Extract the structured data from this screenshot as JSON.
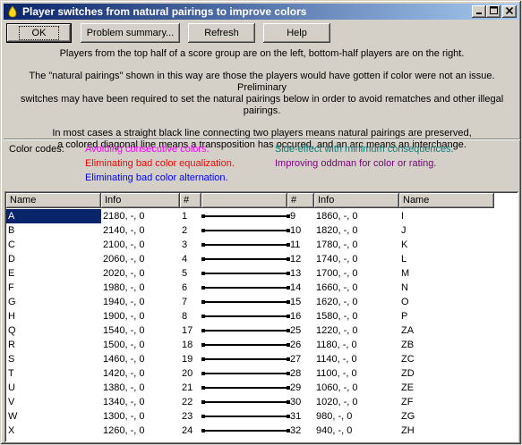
{
  "window": {
    "title": "Player switches from natural pairings to improve colors",
    "buttons": {
      "minimize": "_",
      "maximize": "□",
      "close": "×"
    }
  },
  "toolbar": {
    "ok": "OK",
    "summary": "Problem summary...",
    "refresh": "Refresh",
    "help": "Help"
  },
  "info": {
    "p1": "Players from the top half of a score group are on the left, bottom-half players are on the right.",
    "p2a": "The \"natural pairings\" shown in this way are those the players would have gotten if color were not an issue. Preliminary",
    "p2b": "switches may have been required to set the natural pairings below in order to avoid rematches and other illegal pairings.",
    "p3a": "In most cases a straight black line connecting two players means natural pairings are preserved,",
    "p3b": "a colored diagonal line means a transposition has occured, and an arc means an interchange."
  },
  "color_codes": {
    "label": "Color codes:",
    "items": [
      {
        "text": "Avoiding consecutive colors.",
        "color": "#ff00ff"
      },
      {
        "text": "Side-effect with minimum consequences.",
        "color": "#008080"
      },
      {
        "text": "Eliminating bad color equalization.",
        "color": "#ff0000"
      },
      {
        "text": "Improving oddman for color or rating.",
        "color": "#800080"
      },
      {
        "text": "Eliminating bad color alternation.",
        "color": "#0000ff"
      }
    ]
  },
  "columns": [
    "Name",
    "Info",
    "#",
    "#",
    "Info",
    "Name"
  ],
  "rows": [
    {
      "l_name": "A",
      "l_info": "2180, -, 0",
      "l_num": "1",
      "r_num": "9",
      "r_info": "1860, -, 0",
      "r_name": "I"
    },
    {
      "l_name": "B",
      "l_info": "2140, -, 0",
      "l_num": "2",
      "r_num": "10",
      "r_info": "1820, -, 0",
      "r_name": "J"
    },
    {
      "l_name": "C",
      "l_info": "2100, -, 0",
      "l_num": "3",
      "r_num": "11",
      "r_info": "1780, -, 0",
      "r_name": "K"
    },
    {
      "l_name": "D",
      "l_info": "2060, -, 0",
      "l_num": "4",
      "r_num": "12",
      "r_info": "1740, -, 0",
      "r_name": "L"
    },
    {
      "l_name": "E",
      "l_info": "2020, -, 0",
      "l_num": "5",
      "r_num": "13",
      "r_info": "1700, -, 0",
      "r_name": "M"
    },
    {
      "l_name": "F",
      "l_info": "1980, -, 0",
      "l_num": "6",
      "r_num": "14",
      "r_info": "1660, -, 0",
      "r_name": "N"
    },
    {
      "l_name": "G",
      "l_info": "1940, -, 0",
      "l_num": "7",
      "r_num": "15",
      "r_info": "1620, -, 0",
      "r_name": "O"
    },
    {
      "l_name": "H",
      "l_info": "1900, -, 0",
      "l_num": "8",
      "r_num": "16",
      "r_info": "1580, -, 0",
      "r_name": "P"
    },
    {
      "l_name": "Q",
      "l_info": "1540, -, 0",
      "l_num": "17",
      "r_num": "25",
      "r_info": "1220, -, 0",
      "r_name": "ZA"
    },
    {
      "l_name": "R",
      "l_info": "1500, -, 0",
      "l_num": "18",
      "r_num": "26",
      "r_info": "1180, -, 0",
      "r_name": "ZB"
    },
    {
      "l_name": "S",
      "l_info": "1460, -, 0",
      "l_num": "19",
      "r_num": "27",
      "r_info": "1140, -, 0",
      "r_name": "ZC"
    },
    {
      "l_name": "T",
      "l_info": "1420, -, 0",
      "l_num": "20",
      "r_num": "28",
      "r_info": "1100, -, 0",
      "r_name": "ZD"
    },
    {
      "l_name": "U",
      "l_info": "1380, -, 0",
      "l_num": "21",
      "r_num": "29",
      "r_info": "1060, -, 0",
      "r_name": "ZE"
    },
    {
      "l_name": "V",
      "l_info": "1340, -, 0",
      "l_num": "22",
      "r_num": "30",
      "r_info": "1020, -, 0",
      "r_name": "ZF"
    },
    {
      "l_name": "W",
      "l_info": "1300, -, 0",
      "l_num": "23",
      "r_num": "31",
      "r_info": "980, -, 0",
      "r_name": "ZG"
    },
    {
      "l_name": "X",
      "l_info": "1260, -, 0",
      "l_num": "24",
      "r_num": "32",
      "r_info": "940, -, 0",
      "r_name": "ZH"
    }
  ],
  "selected_row": 0
}
